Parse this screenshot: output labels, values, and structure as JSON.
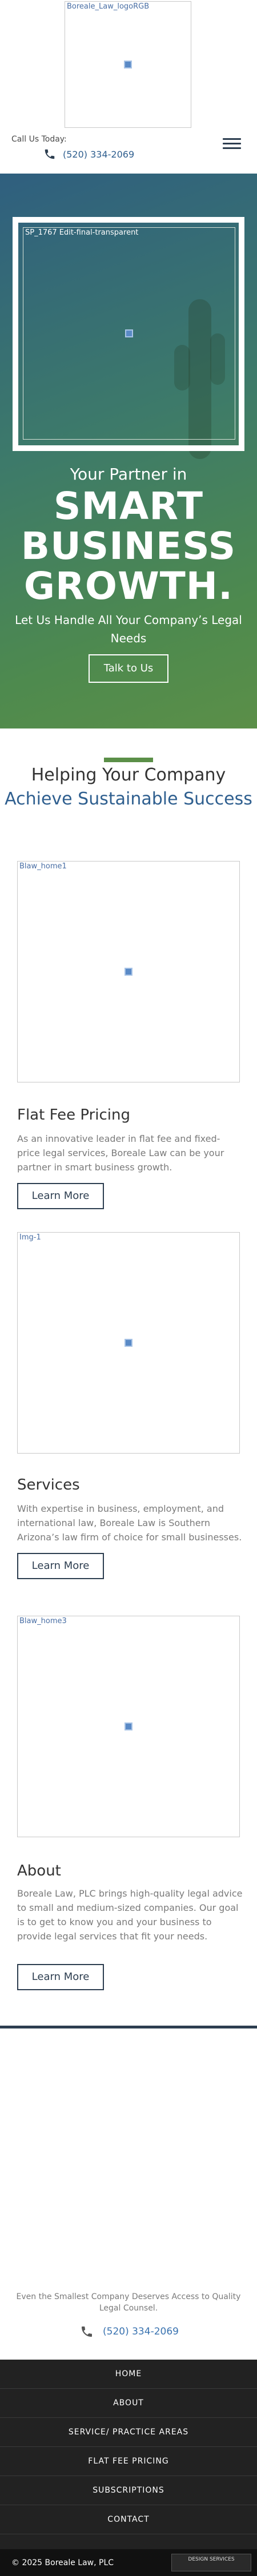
{
  "header": {
    "logo_alt": "Boreale_Law_logoRGB",
    "call_label": "Call Us Today:",
    "phone": "(520) 334-2069"
  },
  "hero": {
    "image_alt": "SP_1767 Edit-final-transparent",
    "kicker": "Your Partner in",
    "title_line1": "SMART",
    "title_line2": "BUSINESS",
    "title_line3": "GROWTH.",
    "subtitle": "Let Us Handle All Your Company’s Legal Needs",
    "cta_label": "Talk to Us"
  },
  "help": {
    "line1": "Helping Your Company",
    "line2": "Achieve Sustainable Success"
  },
  "cards": [
    {
      "image_alt": "Blaw_home1",
      "title": "Flat Fee Pricing",
      "text": "As an innovative leader in flat fee and fixed-price legal services, Boreale Law can be your partner in smart business growth.",
      "button": "Learn More"
    },
    {
      "image_alt": "Img-1",
      "title": "Services",
      "text": "With expertise in business, employment, and international law, Boreale Law is Southern Arizona’s law firm of choice for small businesses.",
      "button": "Learn More"
    },
    {
      "image_alt": "Blaw_home3",
      "title": "About",
      "text": "Boreale Law, PLC brings high-quality legal advice to small and medium-sized companies. Our goal is to get to know you and your business to provide legal services that fit your needs.",
      "button": "Learn More"
    }
  ],
  "tagline": "Even the Smallest Company Deserves Access to Quality Legal Counsel.",
  "footer_phone": "(520) 334-2069",
  "footer_nav": [
    "HOME",
    "ABOUT",
    "SERVICE/ PRACTICE AREAS",
    "FLAT FEE PRICING",
    "SUBSCRIPTIONS",
    "CONTACT"
  ],
  "copyright": "© 2025 Boreale Law, PLC",
  "designer_badge": "DESIGN SERVICES",
  "colors": {
    "accent_green": "#5b8f48",
    "brand_blue": "#2f5f8f",
    "dark_navy": "#2d3e50"
  }
}
